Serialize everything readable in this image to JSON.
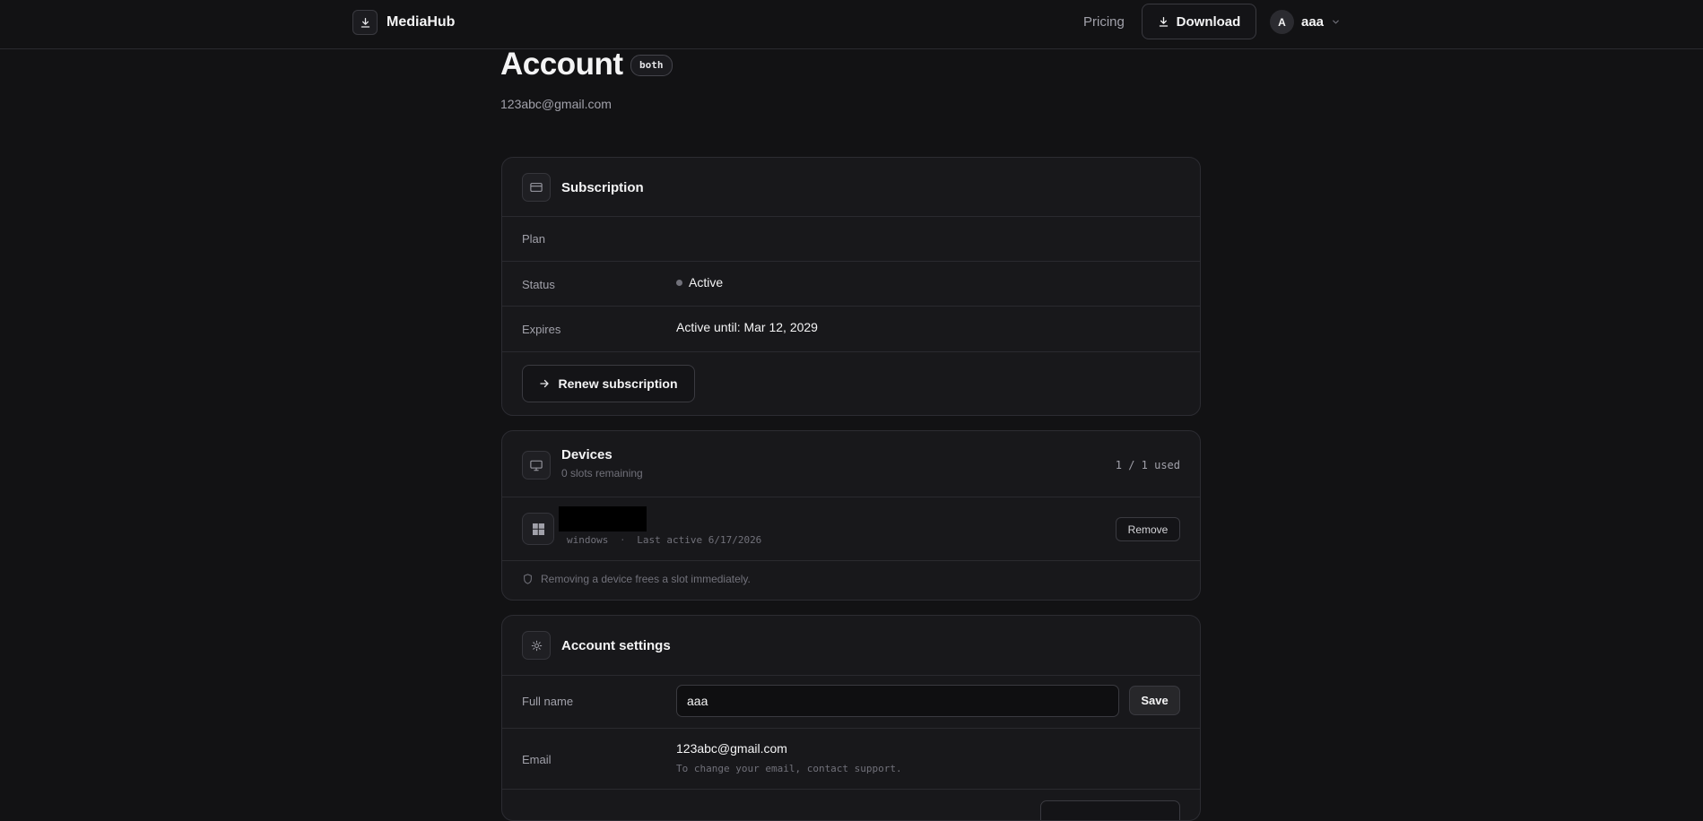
{
  "topbar": {
    "brand": "MediaHub",
    "pricing_label": "Pricing",
    "download_label": "Download",
    "user_initial": "A",
    "user_name": "aaa"
  },
  "header": {
    "title": "Account",
    "badge": "both",
    "email": "123abc@gmail.com"
  },
  "subscription": {
    "title": "Subscription",
    "plan_label": "Plan",
    "plan_value": "",
    "status_label": "Status",
    "status_value": "Active",
    "expires_label": "Expires",
    "expires_value": "Active until: Mar 12, 2029",
    "renew_label": "Renew subscription"
  },
  "devices": {
    "title": "Devices",
    "subtitle": "0 slots remaining",
    "usage": "1 / 1 used",
    "items": [
      {
        "name": "",
        "platform": "windows",
        "separator": "·",
        "last_active": "Last active 6/17/2026",
        "remove_label": "Remove"
      }
    ],
    "footer_note": "Removing a device frees a slot immediately."
  },
  "settings": {
    "title": "Account settings",
    "fullname_label": "Full name",
    "fullname_value": "aaa",
    "save_label": "Save",
    "email_label": "Email",
    "email_value": "123abc@gmail.com",
    "email_hint": "To change your email, contact support."
  },
  "colors": {
    "background": "#121214",
    "card": "#18181b",
    "border": "#2c2c32",
    "status_dot": "#71717a"
  }
}
